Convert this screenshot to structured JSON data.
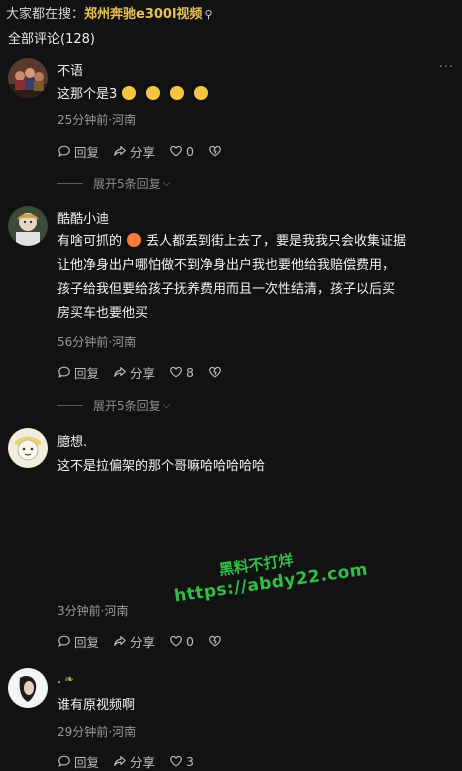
{
  "search_hint": {
    "prefix": "大家都在搜：",
    "term": "郑州奔驰e300l视频"
  },
  "comments_header": "全部评论(128)",
  "comments": [
    {
      "user": "不语",
      "text_lines": [
        "这那个是3"
      ],
      "emoji_count": 4,
      "time": "25分钟前·河南",
      "reply": "回复",
      "share": "分享",
      "likes": "0",
      "expand": "展开5条回复"
    },
    {
      "user": "酷酷小迪",
      "text_lines": [
        "有啥可抓的",
        "丢人都丢到街上去了，要是我我只会收集证据",
        "让他净身出户哪怕做不到净身出户我也要他给我赔偿费用，",
        "孩子给我但要给孩子抚养费用而且一次性结清，孩子以后买",
        "房买车也要他买"
      ],
      "time": "56分钟前·河南",
      "reply": "回复",
      "share": "分享",
      "likes": "8",
      "expand": "展开5条回复"
    },
    {
      "user": "臆想.",
      "text_lines": [
        "这不是拉偏架的那个哥嘛哈哈哈哈哈"
      ],
      "time": "3分钟前·河南",
      "reply": "回复",
      "share": "分享",
      "likes": "0"
    },
    {
      "user": ".",
      "text_lines": [
        "谁有原视频啊"
      ],
      "time": "29分钟前·河南",
      "reply": "回复",
      "share": "分享",
      "likes": "3"
    }
  ],
  "watermark": {
    "line1": "黑料不打烊",
    "line2": "https://abdy22.com"
  },
  "colors": {
    "background": "#121212",
    "highlight": "#e6c25a",
    "watermark": "#2fbf47"
  },
  "icons": {
    "reply": "comment-bubble-icon",
    "share": "share-arrow-icon",
    "like": "heart-icon",
    "dislike": "broken-heart-icon",
    "more": "more-dots-icon",
    "search": "search-icon"
  }
}
